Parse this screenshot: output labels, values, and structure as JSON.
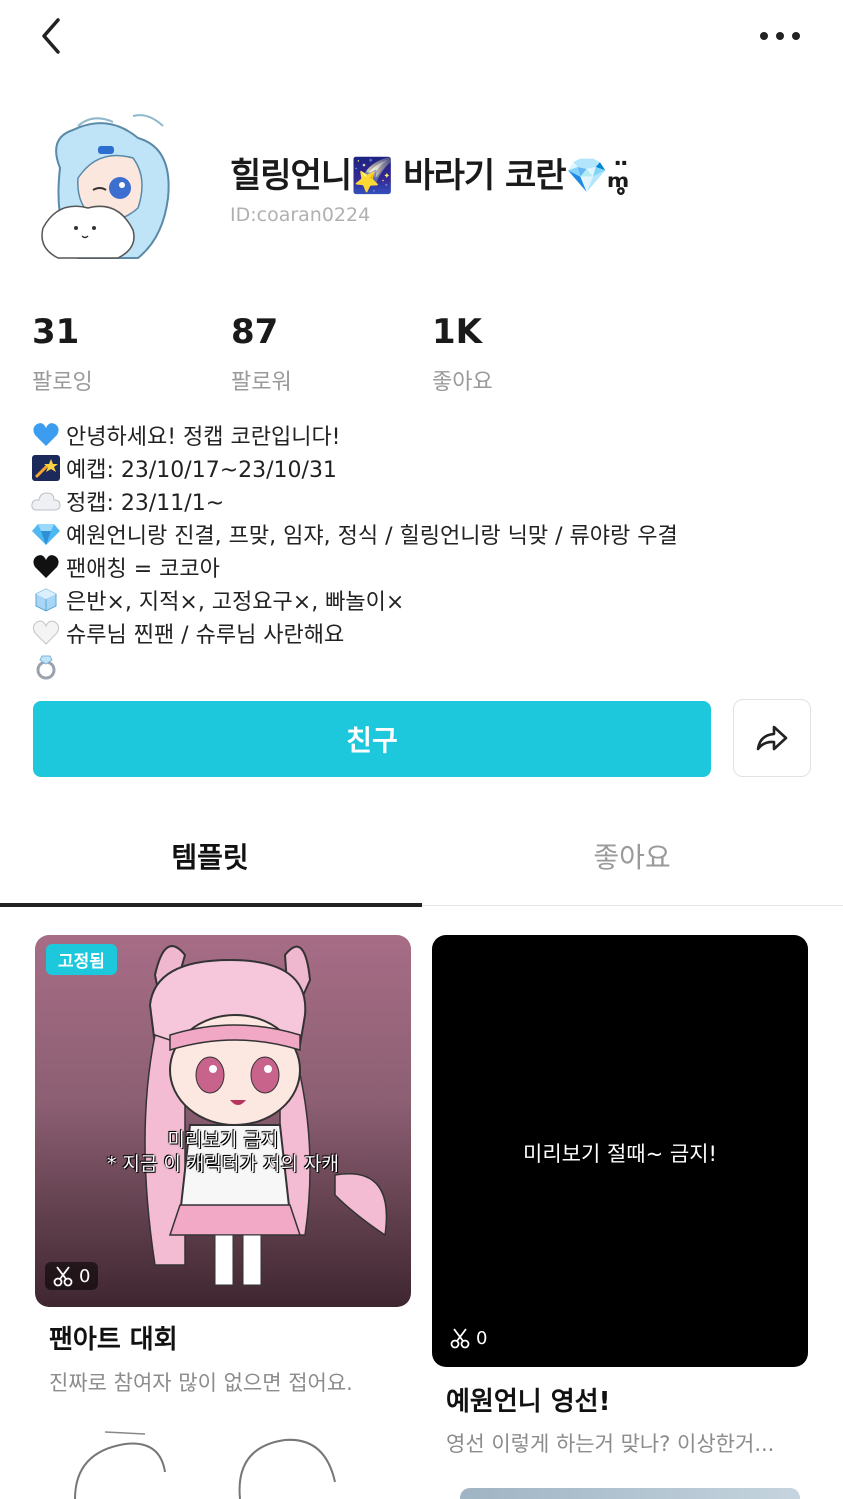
{
  "header": {
    "back_icon": "chevron-left-icon",
    "more_icon": "more-dots-icon"
  },
  "profile": {
    "username": "힐링언니🌠 바라기 코란💎ₘ̥̈",
    "user_id": "ID:coaran0224",
    "stats": [
      {
        "value": "31",
        "label": "팔로잉"
      },
      {
        "value": "87",
        "label": "팔로워"
      },
      {
        "value": "1K",
        "label": "좋아요"
      }
    ],
    "bio": [
      {
        "emoji": "💙",
        "text": "안녕하세요! 정캡 코란입니다!"
      },
      {
        "emoji": "🌠",
        "text": "예캡: 23/10/17~23/10/31"
      },
      {
        "emoji": "☁️",
        "text": "정캡: 23/11/1~"
      },
      {
        "emoji": "💎",
        "text": "예원언니랑 진결, 프맞, 임쟈, 정식 / 힐링언니랑 닉맞 / 류야랑 우결"
      },
      {
        "emoji": "🖤",
        "text": "팬애칭 = 코코아"
      },
      {
        "emoji": "🧊",
        "text": "은반×, 지적×, 고정요구×, 빠놀이×"
      },
      {
        "emoji": "🤍",
        "text": "슈루님 찐팬 / 슈루님 사란해요"
      },
      {
        "emoji": "💍",
        "text": ""
      }
    ]
  },
  "actions": {
    "friend_label": "친구",
    "share_icon": "share-arrow-icon"
  },
  "tabs": [
    {
      "label": "템플릿",
      "active": true
    },
    {
      "label": "좋아요",
      "active": false
    }
  ],
  "cards": [
    {
      "pinned_label": "고정됨",
      "overlay_line1": "미리보기 금지",
      "overlay_line2": "* 지금 이 캐릭터가 저의 자캐",
      "clip_count": "0",
      "title": "팬아트 대회",
      "description": "진짜로 참여자 많이 없으면 접어요."
    },
    {
      "overlay_line1": "미리보기 절때~ 금지!",
      "clip_count": "0",
      "title": "예원언니 영선!",
      "description": "영선 이렇게 하는거 맞나? 이상한거..."
    }
  ],
  "colors": {
    "accent": "#1ec8dc",
    "text": "#1a1a1a",
    "muted": "#9a9a9a"
  }
}
